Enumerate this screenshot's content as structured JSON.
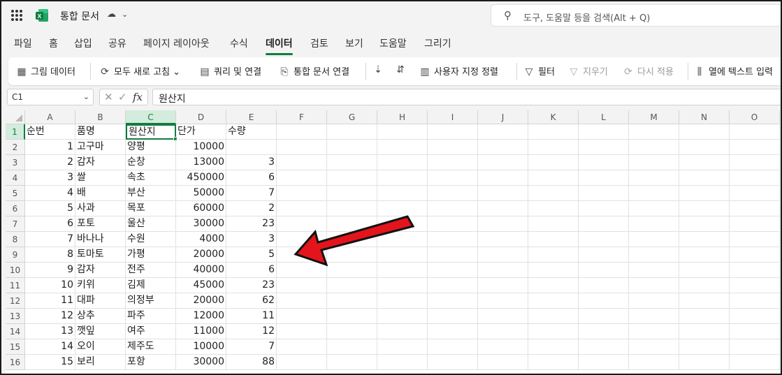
{
  "app": {
    "title": "통합 문서",
    "search_placeholder": "도구, 도움말 등을 검색(Alt + Q)",
    "logo_letter": "X"
  },
  "menu_tabs": [
    "파일",
    "홈",
    "삽입",
    "공유",
    "페이지 레이아웃",
    "수식",
    "데이터",
    "검토",
    "보기",
    "도움말",
    "그리기"
  ],
  "active_tab": "데이터",
  "ribbon": {
    "get_data": "그림 데이터",
    "refresh_all": "모두 새로 고침",
    "queries": "쿼리 및 연결",
    "workbook_links": "통합 문서 연결",
    "sort_az": "",
    "sort_za": "",
    "custom_sort": "사용자 지정 정렬",
    "filter": "필터",
    "clear": "지우기",
    "reapply": "다시 적용",
    "text_to_columns": "열에 텍스트 입력"
  },
  "formula_bar": {
    "name_box": "C1",
    "formula": "원산지"
  },
  "columns": [
    "A",
    "B",
    "C",
    "D",
    "E",
    "F",
    "G",
    "H",
    "I",
    "J",
    "K",
    "L",
    "M",
    "N",
    "O"
  ],
  "rows": [
    "1",
    "2",
    "3",
    "4",
    "5",
    "6",
    "7",
    "8",
    "9",
    "10",
    "11",
    "12",
    "13",
    "14",
    "15",
    "16"
  ],
  "selected_cell": {
    "col": "C",
    "row": "1"
  },
  "headers": [
    "순번",
    "품명",
    "원산지",
    "단가",
    "수량"
  ],
  "data_rows": [
    [
      "1",
      "고구마",
      "양평",
      "10000",
      ""
    ],
    [
      "2",
      "감자",
      "순창",
      "13000",
      "3"
    ],
    [
      "3",
      "쌀",
      "속초",
      "450000",
      "6"
    ],
    [
      "4",
      "배",
      "부산",
      "50000",
      "7"
    ],
    [
      "5",
      "사과",
      "목포",
      "60000",
      "2"
    ],
    [
      "6",
      "포토",
      "울산",
      "30000",
      "23"
    ],
    [
      "7",
      "바나나",
      "수원",
      "4000",
      "3"
    ],
    [
      "8",
      "토마토",
      "가평",
      "20000",
      "5"
    ],
    [
      "9",
      "감자",
      "전주",
      "40000",
      "6"
    ],
    [
      "10",
      "키위",
      "김제",
      "45000",
      "23"
    ],
    [
      "11",
      "대파",
      "의정부",
      "20000",
      "62"
    ],
    [
      "12",
      "상추",
      "파주",
      "12000",
      "11"
    ],
    [
      "13",
      "깻잎",
      "여주",
      "11000",
      "12"
    ],
    [
      "14",
      "오이",
      "제주도",
      "10000",
      "7"
    ],
    [
      "15",
      "보리",
      "포항",
      "30000",
      "88"
    ]
  ],
  "colors": {
    "excel_green": "#107c41",
    "arrow_red": "#e3141c"
  },
  "icons": {
    "app_launcher": "waffle-icon",
    "sync": "cloud-sync-icon",
    "search": "search-icon"
  }
}
